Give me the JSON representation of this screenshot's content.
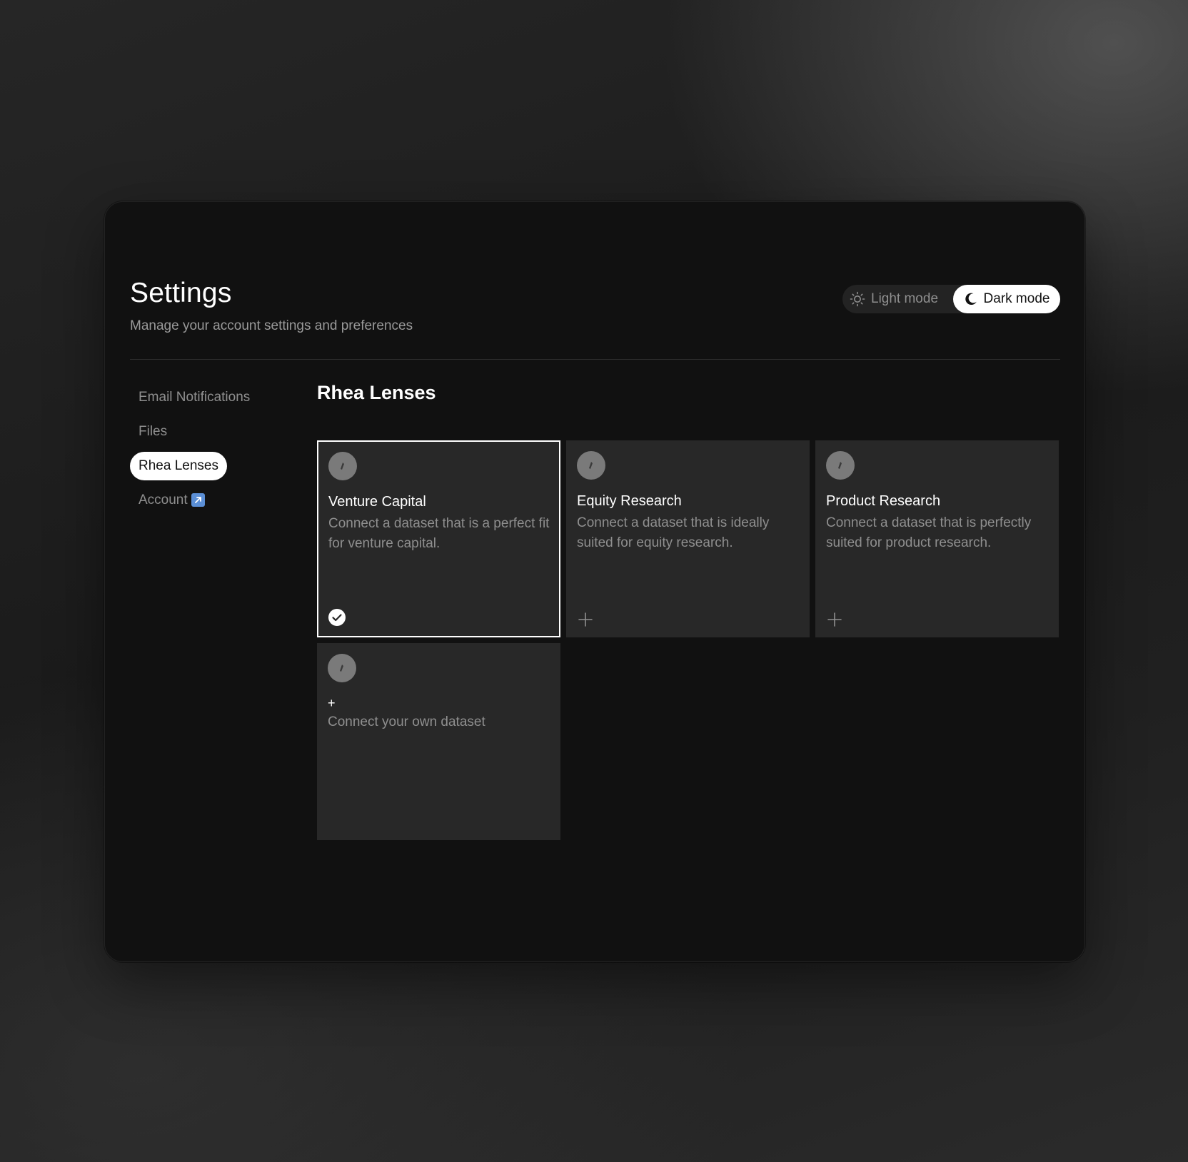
{
  "header": {
    "title": "Settings",
    "subtitle": "Manage your account settings and preferences"
  },
  "mode_toggle": {
    "light_label": "Light mode",
    "dark_label": "Dark mode",
    "selected": "dark"
  },
  "sidebar": {
    "items": [
      {
        "label": "Email Notifications",
        "active": false
      },
      {
        "label": "Files",
        "active": false
      },
      {
        "label": "Rhea Lenses",
        "active": true
      },
      {
        "label": "Account",
        "active": false,
        "icon": "external-link-icon"
      }
    ]
  },
  "main": {
    "section_title": "Rhea Lenses",
    "lenses": [
      {
        "title": "Venture Capital",
        "description": "Connect a dataset that is a perfect fit for venture capital.",
        "selected": true,
        "action_icon": "check-circle-icon"
      },
      {
        "title": "Equity Research",
        "description": "Connect a dataset that is ideally suited for equity research.",
        "selected": false,
        "action_icon": "plus-icon"
      },
      {
        "title": "Product Research",
        "description": "Connect a dataset that is perfectly suited for product research.",
        "selected": false,
        "action_icon": "plus-icon"
      }
    ],
    "own_dataset": {
      "plus": "+",
      "label": "Connect your own dataset"
    }
  },
  "colors": {
    "card_bg": "#111111",
    "tile_bg": "#282828",
    "muted_text": "#8f8f8f",
    "accent_link": "#5b8fd6"
  }
}
